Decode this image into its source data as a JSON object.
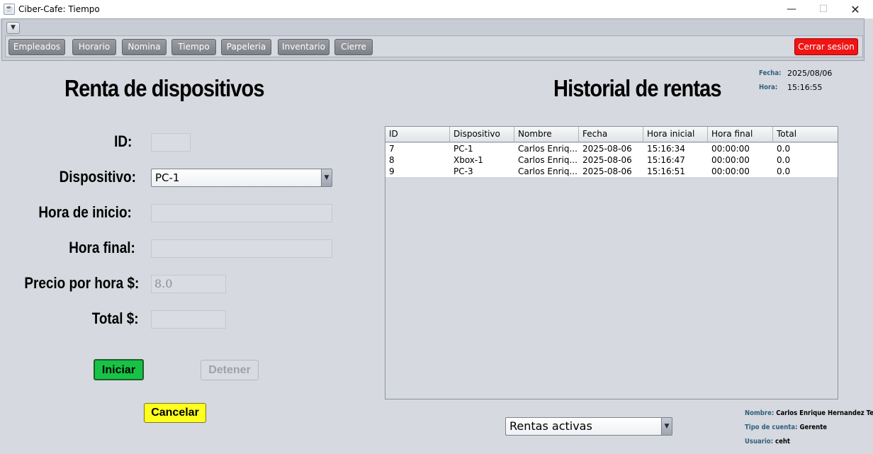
{
  "window": {
    "title": "Ciber-Cafe: Tiempo",
    "minimize": "—",
    "maximize": "☐",
    "close": "✕"
  },
  "toolbar": {
    "collapse_glyph": "▼",
    "nav": [
      "Empleados",
      "Horario",
      "Nomina",
      "Tiempo",
      "Papeleria",
      "Inventario",
      "Cierre"
    ],
    "logout_label": "Cerrar sesion",
    "logout_color": "#f01414"
  },
  "datetime": {
    "fecha_label": "Fecha:",
    "fecha_value": "2025/08/06",
    "hora_label": "Hora:",
    "hora_value": "15:16:55"
  },
  "left": {
    "title": "Renta de dispositivos",
    "id_label": "ID:",
    "id_value": "",
    "device_label": "Dispositivo:",
    "device_selected": "PC-1",
    "start_label": "Hora de inicio:",
    "start_value": "",
    "end_label": "Hora final:",
    "end_value": "",
    "price_label": "Precio por hora $:",
    "price_value": "8.0",
    "total_label": "Total $:",
    "total_value": "",
    "start_button": "Iniciar",
    "stop_button": "Detener",
    "cancel_button": "Cancelar"
  },
  "right": {
    "title": "Historial de rentas",
    "columns": [
      "ID",
      "Dispositivo",
      "Nombre",
      "Fecha",
      "Hora inicial",
      "Hora final",
      "Total"
    ],
    "rows": [
      [
        "7",
        "PC-1",
        "Carlos Enriq...",
        "2025-08-06",
        "15:16:34",
        "00:00:00",
        "0.0"
      ],
      [
        "8",
        "Xbox-1",
        "Carlos Enriq...",
        "2025-08-06",
        "15:16:47",
        "00:00:00",
        "0.0"
      ],
      [
        "9",
        "PC-3",
        "Carlos Enriq...",
        "2025-08-06",
        "15:16:51",
        "00:00:00",
        "0.0"
      ]
    ],
    "filter_selected": "Rentas activas"
  },
  "user": {
    "name_label": "Nombre:",
    "name_value": "Carlos Enrique Hernandez Tellez",
    "type_label": "Tipo de cuenta:",
    "type_value": "Gerente",
    "user_label": "Usuario:",
    "user_value": "ceht"
  },
  "colors": {
    "accent_label": "#2e5f7d",
    "start_button": "#17c345",
    "cancel_button": "#ffff1e"
  }
}
